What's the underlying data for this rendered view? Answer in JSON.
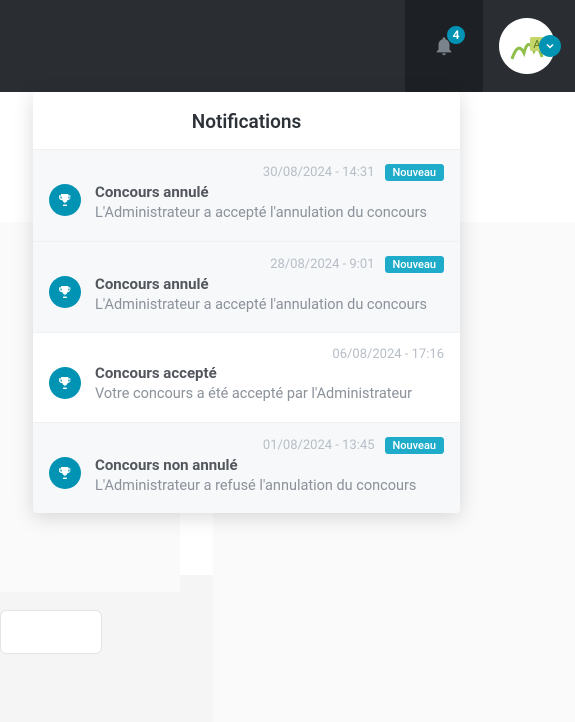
{
  "header": {
    "notification_count": "4"
  },
  "dropdown": {
    "title": "Notifications",
    "new_label": "Nouveau",
    "items": [
      {
        "time": "30/08/2024 - 14:31",
        "title": "Concours annulé",
        "desc": "L'Administrateur a accepté l'annulation du concours",
        "is_new": true
      },
      {
        "time": "28/08/2024 - 9:01",
        "title": "Concours annulé",
        "desc": "L'Administrateur a accepté l'annulation du concours",
        "is_new": true
      },
      {
        "time": "06/08/2024 - 17:16",
        "title": "Concours accepté",
        "desc": "Votre concours a été accepté par l'Administrateur",
        "is_new": false
      },
      {
        "time": "01/08/2024 - 13:45",
        "title": "Concours non annulé",
        "desc": "L'Administrateur a refusé l'annulation du concours",
        "is_new": true
      }
    ]
  }
}
